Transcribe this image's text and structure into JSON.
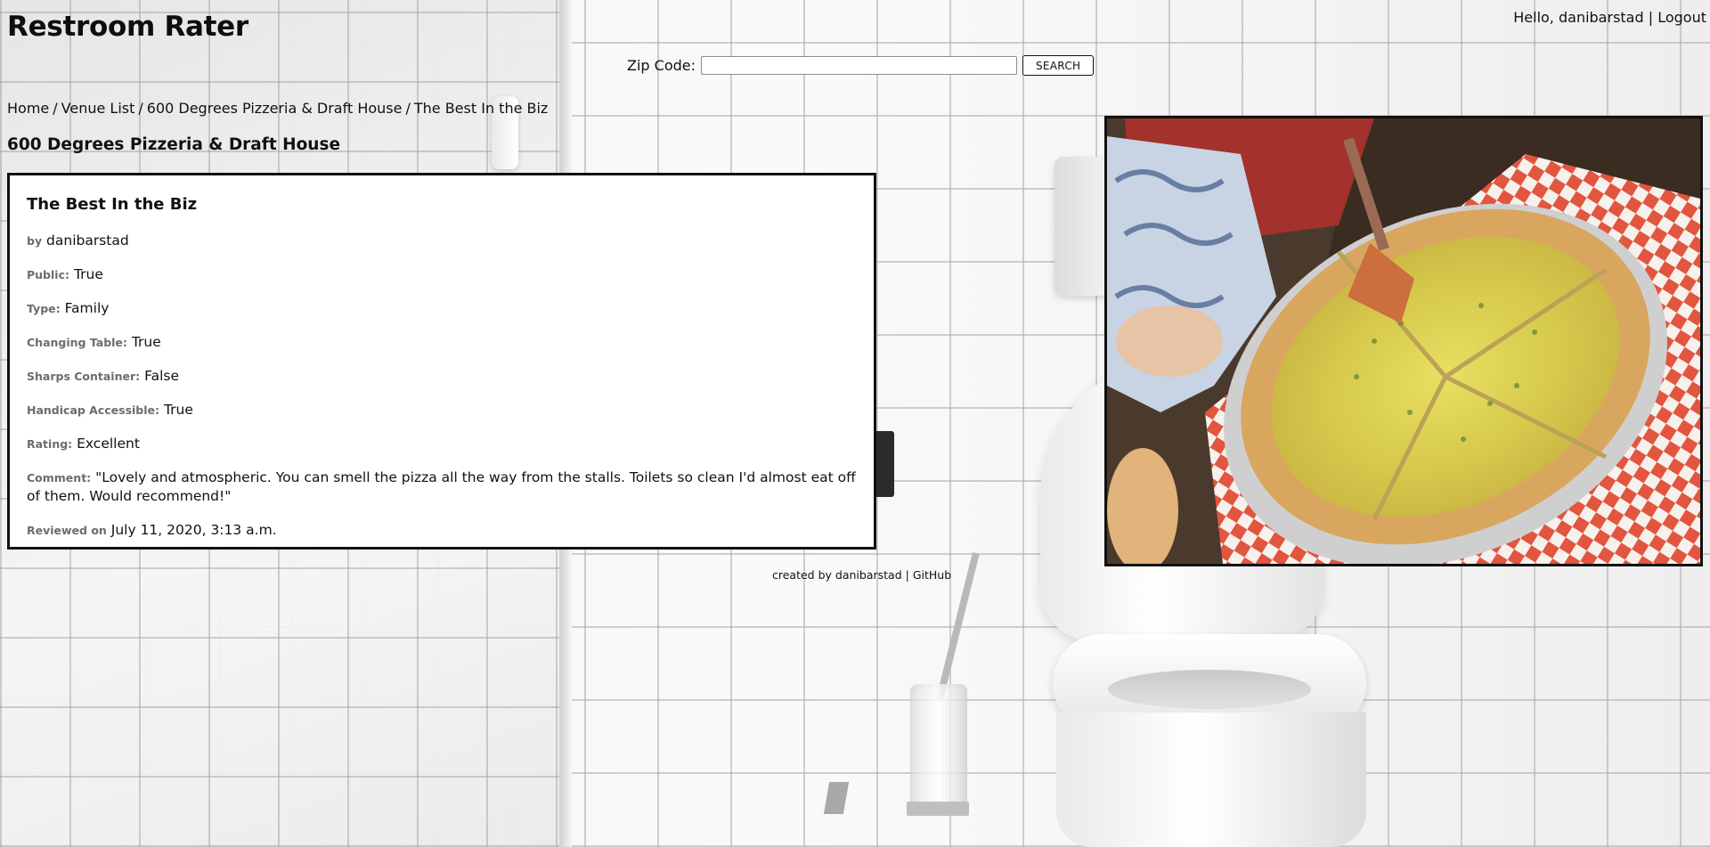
{
  "site": {
    "title": "Restroom Rater"
  },
  "user_nav": {
    "greeting": "Hello, danibarstad",
    "separator": "|",
    "logout": "Logout"
  },
  "search": {
    "label": "Zip Code:",
    "value": "",
    "button": "SEARCH"
  },
  "breadcrumb": {
    "items": [
      "Home",
      "Venue List",
      "600 Degrees Pizzeria & Draft House",
      "The Best In the Biz"
    ],
    "separator": "/"
  },
  "venue": {
    "name": "600 Degrees Pizzeria & Draft House"
  },
  "review": {
    "title": "The Best In the Biz",
    "author_label": "by",
    "author": "danibarstad",
    "fields": [
      {
        "label": "Public:",
        "value": "True"
      },
      {
        "label": "Type:",
        "value": "Family"
      },
      {
        "label": "Changing Table:",
        "value": "True"
      },
      {
        "label": "Sharps Container:",
        "value": "False"
      },
      {
        "label": "Handicap Accessible:",
        "value": "True"
      },
      {
        "label": "Rating:",
        "value": "Excellent"
      }
    ],
    "comment_label": "Comment:",
    "comment": "\"Lovely and atmospheric. You can smell the pizza all the way from the stalls. Toilets so clean I'd almost eat off of them. Would recommend!\"",
    "reviewed_label": "Reviewed on",
    "reviewed_date": "July 11, 2020, 3:13 a.m."
  },
  "footer": {
    "text": "created by danibarstad",
    "separator": "|",
    "link": "GitHub"
  },
  "colors": {
    "label_gray": "#6c6c6c",
    "border": "#111111",
    "card_bg": "#ffffff"
  }
}
